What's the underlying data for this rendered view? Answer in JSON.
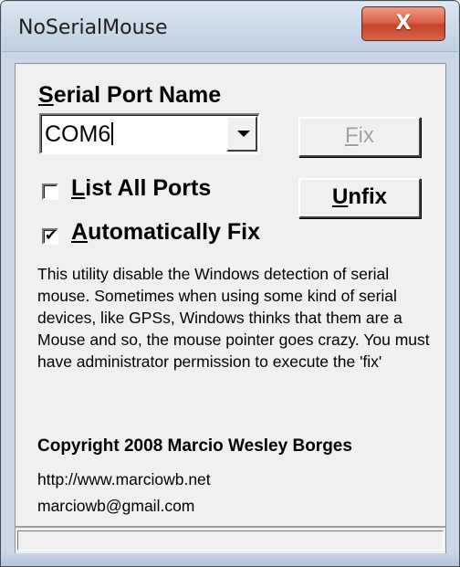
{
  "window": {
    "title": "NoSerialMouse",
    "close_glyph": "X"
  },
  "serial_port": {
    "label_accesskey": "S",
    "label_rest": "erial Port Name",
    "selected_value": "COM6"
  },
  "buttons": {
    "fix_accesskey": "F",
    "fix_rest": "ix",
    "fix_enabled": false,
    "unfix_accesskey": "U",
    "unfix_rest": "nfix",
    "unfix_enabled": true
  },
  "options": {
    "list_all_ports_accesskey": "L",
    "list_all_ports_rest": "ist All Ports",
    "list_all_ports_checked": false,
    "automatically_fix_accesskey": "A",
    "automatically_fix_rest": "utomatically Fix",
    "automatically_fix_checked": true,
    "check_glyph": "✔"
  },
  "info": {
    "description": "This utility disable the Windows detection of serial mouse. Sometimes when using some kind of serial devices, like GPSs, Windows thinks that them are a Mouse and so, the mouse pointer goes crazy. You must have administrator permission to execute the 'fix'",
    "copyright": "Copyright 2008 Marcio Wesley Borges",
    "website": "http://www.marciowb.net",
    "email": "marciowb@gmail.com"
  },
  "status_bar": {
    "text": ""
  },
  "colors": {
    "title_bar": "#cddbea",
    "close_button": "#c7422a",
    "dialog_background": "#f0f0f0",
    "disabled_text": "#a0a0a0"
  },
  "icons": {
    "close": "close-icon",
    "dropdown": "chevron-down-icon",
    "check": "checkmark-icon"
  }
}
